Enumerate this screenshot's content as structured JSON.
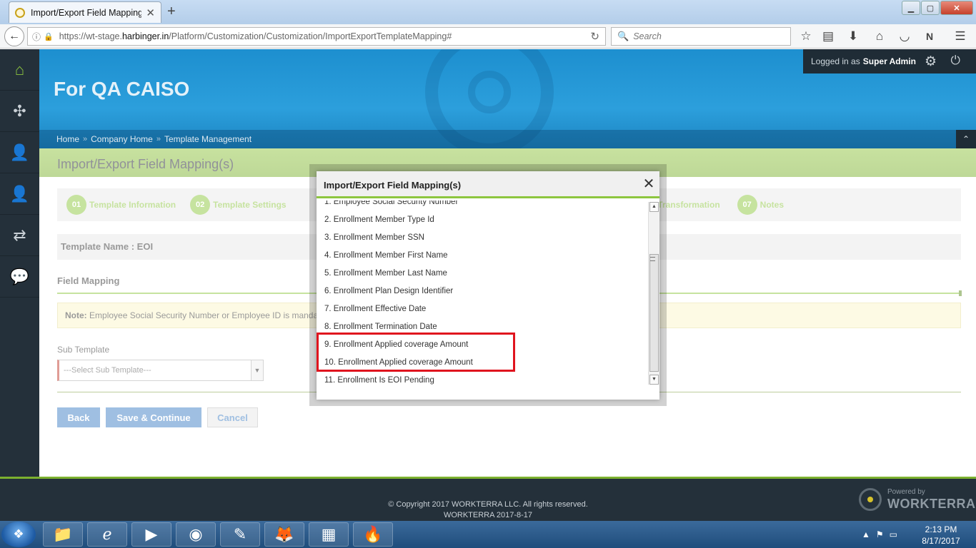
{
  "browser": {
    "tab_title": "Import/Export Field Mapping(",
    "tab_close": "✕",
    "new_tab": "+",
    "url_prefix": "https://wt-stage.",
    "url_domain": "harbinger.in",
    "url_path": "/Platform/Customization/Customization/ImportExportTemplateMapping#",
    "search_placeholder": "Search",
    "win_min": "▁",
    "win_max": "▢",
    "win_close": "✕"
  },
  "header": {
    "org_title": "For QA CAISO",
    "logged_in_prefix": "Logged in as",
    "logged_in_user": "Super Admin"
  },
  "breadcrumb": [
    "Home",
    "Company Home",
    "Template Management"
  ],
  "page": {
    "title": "Import/Export Field Mapping(s)",
    "steps": [
      {
        "num": "01",
        "label": "Template Information"
      },
      {
        "num": "02",
        "label": "Template Settings"
      }
    ],
    "step_partial": {
      "label": "Transformation"
    },
    "step_last": {
      "num": "07",
      "label": "Notes"
    },
    "template_name": "Template Name : EOI",
    "field_mapping_heading": "Field Mapping",
    "note_label": "Note:",
    "note_text": "Employee Social Security Number or Employee ID is mandatory for I",
    "sub_template_label": "Sub Template",
    "sub_template_value": "---Select Sub Template---",
    "buttons": {
      "back": "Back",
      "save": "Save & Continue",
      "cancel": "Cancel"
    }
  },
  "modal": {
    "title": "Import/Export Field Mapping(s)",
    "close": "✕",
    "items": [
      "1. Employee Social Security Number",
      "2. Enrollment Member Type Id",
      "3. Enrollment Member SSN",
      "4. Enrollment Member First Name",
      "5. Enrollment Member Last Name",
      "6. Enrollment Plan Design Identifier",
      "7. Enrollment Effective Date",
      "8. Enrollment Termination Date",
      "9. Enrollment Applied coverage Amount",
      "10. Enrollment Applied coverage Amount",
      "11. Enrollment Is EOI Pending"
    ]
  },
  "footer": {
    "copyright": "© Copyright 2017 WORKTERRA LLC. All rights reserved.",
    "version": "WORKTERRA 2017-8-17",
    "powered_by": "Powered by",
    "brand": "WORKTERRA"
  },
  "taskbar": {
    "time": "2:13 PM",
    "date": "8/17/2017"
  },
  "colors": {
    "accent_green": "#8dc63f",
    "header_blue": "#2c9fdc",
    "dark_nav": "#24303a",
    "button_blue": "#3f7fc4",
    "highlight_red": "#e0141e"
  }
}
